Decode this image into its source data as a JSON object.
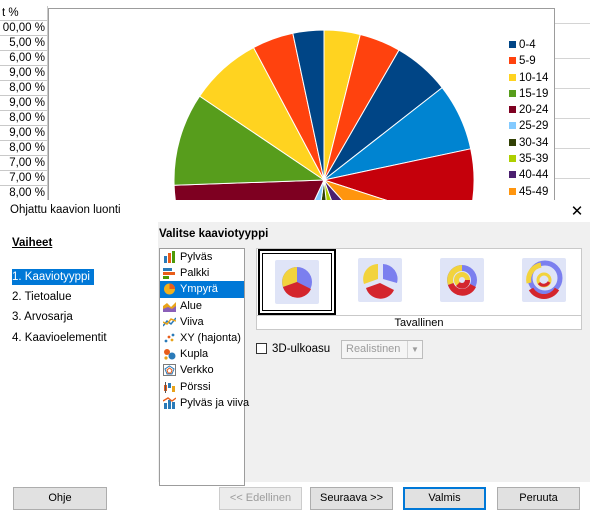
{
  "spreadsheet": {
    "cells": [
      "t %",
      "00,00 %",
      "5,00 %",
      "6,00 %",
      "9,00 %",
      "8,00 %",
      "9,00 %",
      "8,00 %",
      "9,00 %",
      "8,00 %",
      "7,00 %",
      "7,00 %",
      "8,00 %"
    ]
  },
  "chart_data": {
    "type": "pie",
    "categories": [
      "0-4",
      "5-9",
      "10-14",
      "15-19",
      "20-24",
      "25-29",
      "30-34",
      "35-39",
      "40-44",
      "45-49"
    ],
    "legend_position": "right",
    "colors": [
      "#004586",
      "#ff420e",
      "#ffd320",
      "#579d1c",
      "#7e0021",
      "#83caff",
      "#314004",
      "#aecf00",
      "#4b1f6f",
      "#ff950e",
      "#c5000b",
      "#0084d1"
    ],
    "visible_slices_clockwise_from_top": [
      "#ffd320",
      "#ff420e",
      "#004586",
      "#0084d1",
      "#c5000b",
      "#ff950e",
      "#4b1f6f",
      "#aecf00",
      "#314004",
      "#83caff",
      "#7e0021",
      "#579d1c",
      "#ffd320",
      "#ff420e",
      "#004586"
    ]
  },
  "dialog": {
    "title": "Ohjattu kaavion luonti",
    "close_icon": "close-icon",
    "steps_heading": "Vaiheet",
    "steps": [
      "1. Kaaviotyyppi",
      "2. Tietoalue",
      "3. Arvosarja",
      "4. Kaavioelementit"
    ],
    "active_step": 0,
    "chart_type_heading": "Valitse kaaviotyyppi",
    "chart_types": [
      {
        "label": "Pylväs",
        "icon": "bar-chart-icon"
      },
      {
        "label": "Palkki",
        "icon": "horizontal-bar-icon"
      },
      {
        "label": "Ympyrä",
        "icon": "pie-chart-icon"
      },
      {
        "label": "Alue",
        "icon": "area-chart-icon"
      },
      {
        "label": "Viiva",
        "icon": "line-chart-icon"
      },
      {
        "label": "XY (hajonta)",
        "icon": "scatter-chart-icon"
      },
      {
        "label": "Kupla",
        "icon": "bubble-chart-icon"
      },
      {
        "label": "Verkko",
        "icon": "net-chart-icon"
      },
      {
        "label": "Pörssi",
        "icon": "stock-chart-icon"
      },
      {
        "label": "Pylväs ja viiva",
        "icon": "column-line-chart-icon"
      }
    ],
    "selected_chart_type": 2,
    "variants": [
      "normal-pie-icon",
      "exploded-pie-icon",
      "donut-icon",
      "exploded-donut-icon"
    ],
    "selected_variant": 0,
    "variant_label": "Tavallinen",
    "option_3d_label": "3D-ulkoasu",
    "option_3d_checked": false,
    "option_3d_select_value": "Realistinen",
    "buttons": {
      "help": "Ohje",
      "back": "<< Edellinen",
      "next": "Seuraava >>",
      "finish": "Valmis",
      "cancel": "Peruuta"
    }
  }
}
